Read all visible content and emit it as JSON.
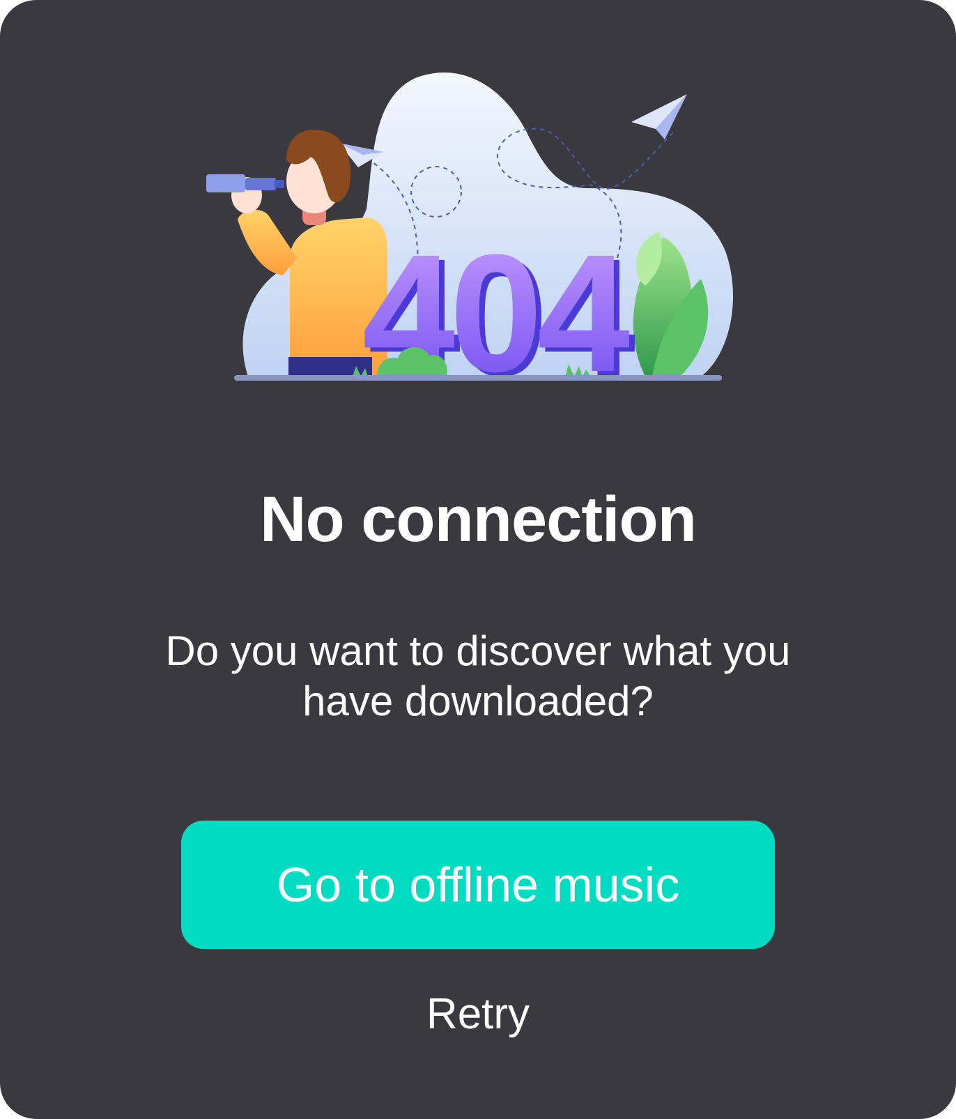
{
  "illustration": {
    "big_number": "404",
    "icon": "person-with-telescope-illustration"
  },
  "dialog": {
    "title": "No connection",
    "message": "Do you want to discover what you have downloaded?",
    "primary_button_label": "Go to offline music",
    "secondary_button_label": "Retry"
  },
  "colors": {
    "background": "#3a393f",
    "accent": "#00dcc2",
    "text": "#ffffff",
    "number_purple": "#8b5cf6"
  }
}
